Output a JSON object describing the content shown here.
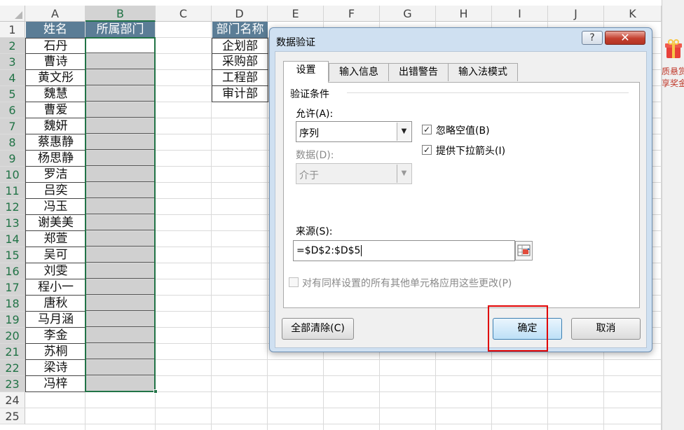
{
  "sheet": {
    "columns": [
      "A",
      "B",
      "C",
      "D",
      "E",
      "F",
      "G",
      "H",
      "I",
      "J",
      "K"
    ],
    "rows": [
      "1",
      "2",
      "3",
      "4",
      "5",
      "6",
      "7",
      "8",
      "9",
      "10",
      "11",
      "12",
      "13",
      "14",
      "15",
      "16",
      "17",
      "18",
      "19",
      "20",
      "21",
      "22",
      "23",
      "24",
      "25"
    ],
    "header_name": "姓名",
    "header_dept": "所属部门",
    "names": [
      "石丹",
      "曹诗",
      "黄文彤",
      "魏慧",
      "曹爱",
      "魏妍",
      "蔡惠静",
      "杨思静",
      "罗洁",
      "吕奕",
      "冯玉",
      "谢美美",
      "郑萱",
      "吴可",
      "刘雯",
      "程小一",
      "唐秋",
      "马月涵",
      "李金",
      "苏桐",
      "梁诗",
      "冯梓"
    ],
    "dept_header": "部门名称",
    "departments": [
      "企划部",
      "采购部",
      "工程部",
      "审计部"
    ]
  },
  "side_panel": {
    "line1": "质悬赏",
    "line2": "享奖金"
  },
  "dialog": {
    "title": "数据验证",
    "help": "?",
    "close": "✕",
    "tabs": [
      "设置",
      "输入信息",
      "出错警告",
      "输入法模式"
    ],
    "group_label": "验证条件",
    "allow_label": "允许(A):",
    "allow_value": "序列",
    "data_label": "数据(D):",
    "data_value": "介于",
    "ignore_blank": "忽略空值(B)",
    "dropdown_arrow": "提供下拉箭头(I)",
    "source_label": "来源(S):",
    "source_value": "=$D$2:$D$5",
    "apply_all": "对有同样设置的所有其他单元格应用这些更改(P)",
    "clear_all": "全部清除(C)",
    "ok": "确定",
    "cancel": "取消"
  },
  "colors": {
    "header_fill": "#5b7d96",
    "selection": "#217346",
    "highlight": "#e00000"
  }
}
